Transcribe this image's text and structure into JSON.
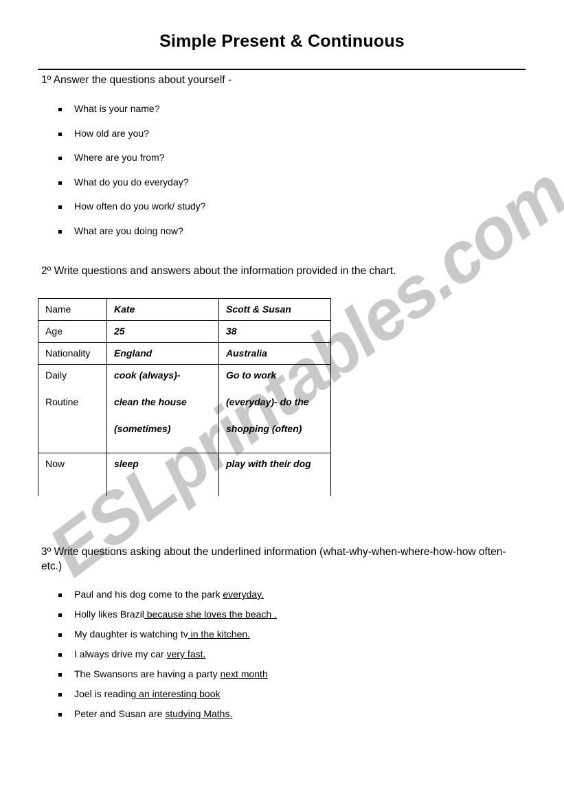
{
  "document": {
    "title": "Simple Present & Continuous",
    "watermark": "ESLprintables.com"
  },
  "section1": {
    "instruction": "1º Answer the questions about yourself -",
    "questions": [
      "What is your name?",
      "How old are you?",
      "Where are you from?",
      "What do you do everyday?",
      "How often do you work/ study?",
      "What are you doing now?"
    ]
  },
  "section2": {
    "instruction": "2º Write questions and answers about the information provided in the chart.",
    "table": {
      "rows": [
        {
          "label": "Name",
          "kate": "Kate",
          "scott": "Scott & Susan"
        },
        {
          "label": "Age",
          "kate": "25",
          "scott": "38"
        },
        {
          "label": "Nationality",
          "kate": "England",
          "scott": "Australia"
        },
        {
          "label_line1": "Daily",
          "label_line2": "Routine",
          "kate_line1": "cook (always)-",
          "kate_line2": "clean the house",
          "kate_line3": "(sometimes)",
          "scott_line1": "Go to work",
          "scott_line2": "(everyday)- do the",
          "scott_line3": "shopping (often)"
        },
        {
          "label": "Now",
          "kate": "sleep",
          "scott": "play with their dog"
        }
      ]
    }
  },
  "section3": {
    "instruction": "3º Write questions asking about the underlined information (what-why-when-where-how-how often-etc.)",
    "sentences": [
      {
        "plain1": "Paul and his dog come to the park ",
        "underlined": "everyday.",
        "plain2": ""
      },
      {
        "plain1": "Holly  likes Brazil",
        "underlined": " because she loves the beach .",
        "plain2": ""
      },
      {
        "plain1": "My daughter is watching tv",
        "underlined": " in the kitchen.",
        "plain2": ""
      },
      {
        "plain1": "I always drive my car ",
        "underlined": "very fast.",
        "plain2": ""
      },
      {
        "plain1": "The Swansons are having a party ",
        "underlined": "next month",
        "plain2": ""
      },
      {
        "plain1": " Joel is reading",
        "underlined": " an interesting book",
        "plain2": ""
      },
      {
        "plain1": "Peter and Susan are ",
        "underlined": "studying Maths.",
        "plain2": ""
      }
    ]
  }
}
